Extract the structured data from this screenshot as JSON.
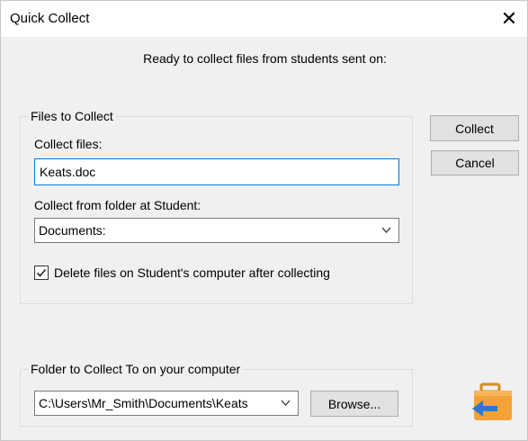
{
  "window": {
    "title": "Quick Collect",
    "close_glyph": "✕"
  },
  "message": "Ready to collect files from students sent on:",
  "files_group": {
    "legend": "Files to Collect",
    "collect_files_label": "Collect files:",
    "collect_files_value": "Keats.doc",
    "collect_from_label": "Collect from folder at Student:",
    "collect_from_value": "Documents:",
    "delete_checkbox_label": "Delete files on Student's computer after collecting",
    "delete_checked": true
  },
  "buttons": {
    "collect": "Collect",
    "cancel": "Cancel",
    "browse": "Browse..."
  },
  "folder_group": {
    "legend": "Folder to Collect To on your computer",
    "path_value": "C:\\Users\\Mr_Smith\\Documents\\Keats"
  },
  "icons": {
    "close": "close-icon",
    "dropdown": "chevron-down-icon",
    "check": "checkmark-icon",
    "app": "briefcase-collect-icon"
  },
  "colors": {
    "focus_border": "#0078d7",
    "briefcase": "#f4a235",
    "arrow": "#2b78d0"
  }
}
